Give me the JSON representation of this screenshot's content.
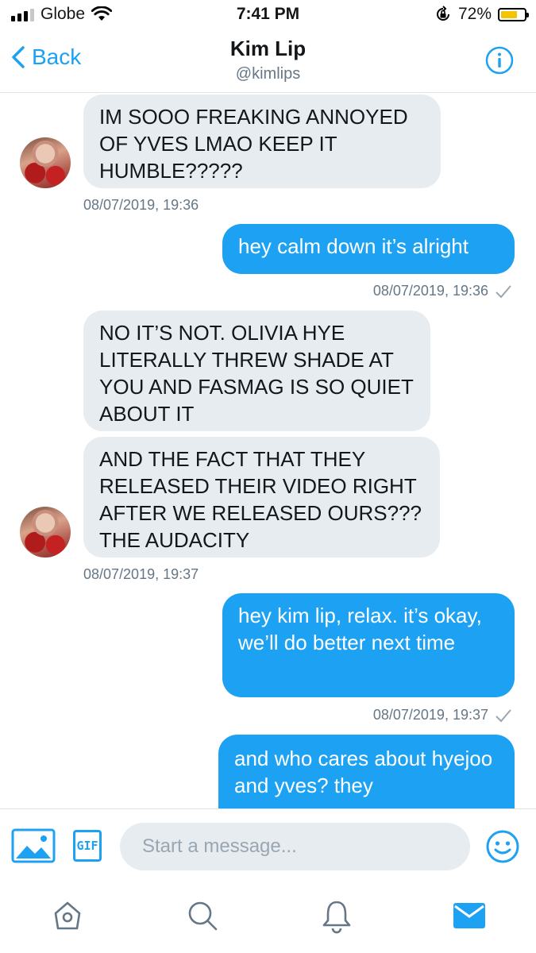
{
  "status_bar": {
    "carrier": "Globe",
    "time": "7:41 PM",
    "battery": "72%",
    "battery_level": 0.72,
    "battery_color": "#f5c400"
  },
  "header": {
    "back_label": "Back",
    "title": "Kim Lip",
    "handle": "@kimlips",
    "info_icon": "info-icon"
  },
  "messages": [
    {
      "direction": "incoming",
      "text": "IM SOOO FREAKING ANNOYED OF YVES LMAO KEEP IT HUMBLE?????",
      "timestamp": "08/07/2019, 19:36"
    },
    {
      "direction": "outgoing",
      "text": "hey calm down it’s alright",
      "timestamp": "08/07/2019, 19:36"
    },
    {
      "direction": "incoming",
      "text": "NO IT’S NOT. OLIVIA HYE LITERALLY THREW SHADE AT YOU AND FASMAG IS SO QUIET ABOUT IT"
    },
    {
      "direction": "incoming",
      "text": "AND THE FACT THAT THEY RELEASED THEIR VIDEO RIGHT AFTER WE RELEASED OURS??? THE AUDACITY",
      "timestamp": "08/07/2019, 19:37"
    },
    {
      "direction": "outgoing",
      "text": "hey kim lip, relax. it’s okay, we’ll do better next time",
      "timestamp": "08/07/2019, 19:37"
    },
    {
      "direction": "outgoing",
      "text": "and who cares about hyejoo and yves? they"
    }
  ],
  "composer": {
    "placeholder": "Start a message...",
    "gif_label": "GIF",
    "icons": [
      "image-icon",
      "gif-icon",
      "emoji-icon"
    ]
  },
  "tabbar": {
    "icons": [
      "home-icon",
      "search-icon",
      "notifications-icon",
      "messages-icon"
    ],
    "active": "messages-icon"
  },
  "colors": {
    "accent": "#1da1f2",
    "incoming_bubble": "#e6ecf0",
    "muted_text": "#657786"
  }
}
